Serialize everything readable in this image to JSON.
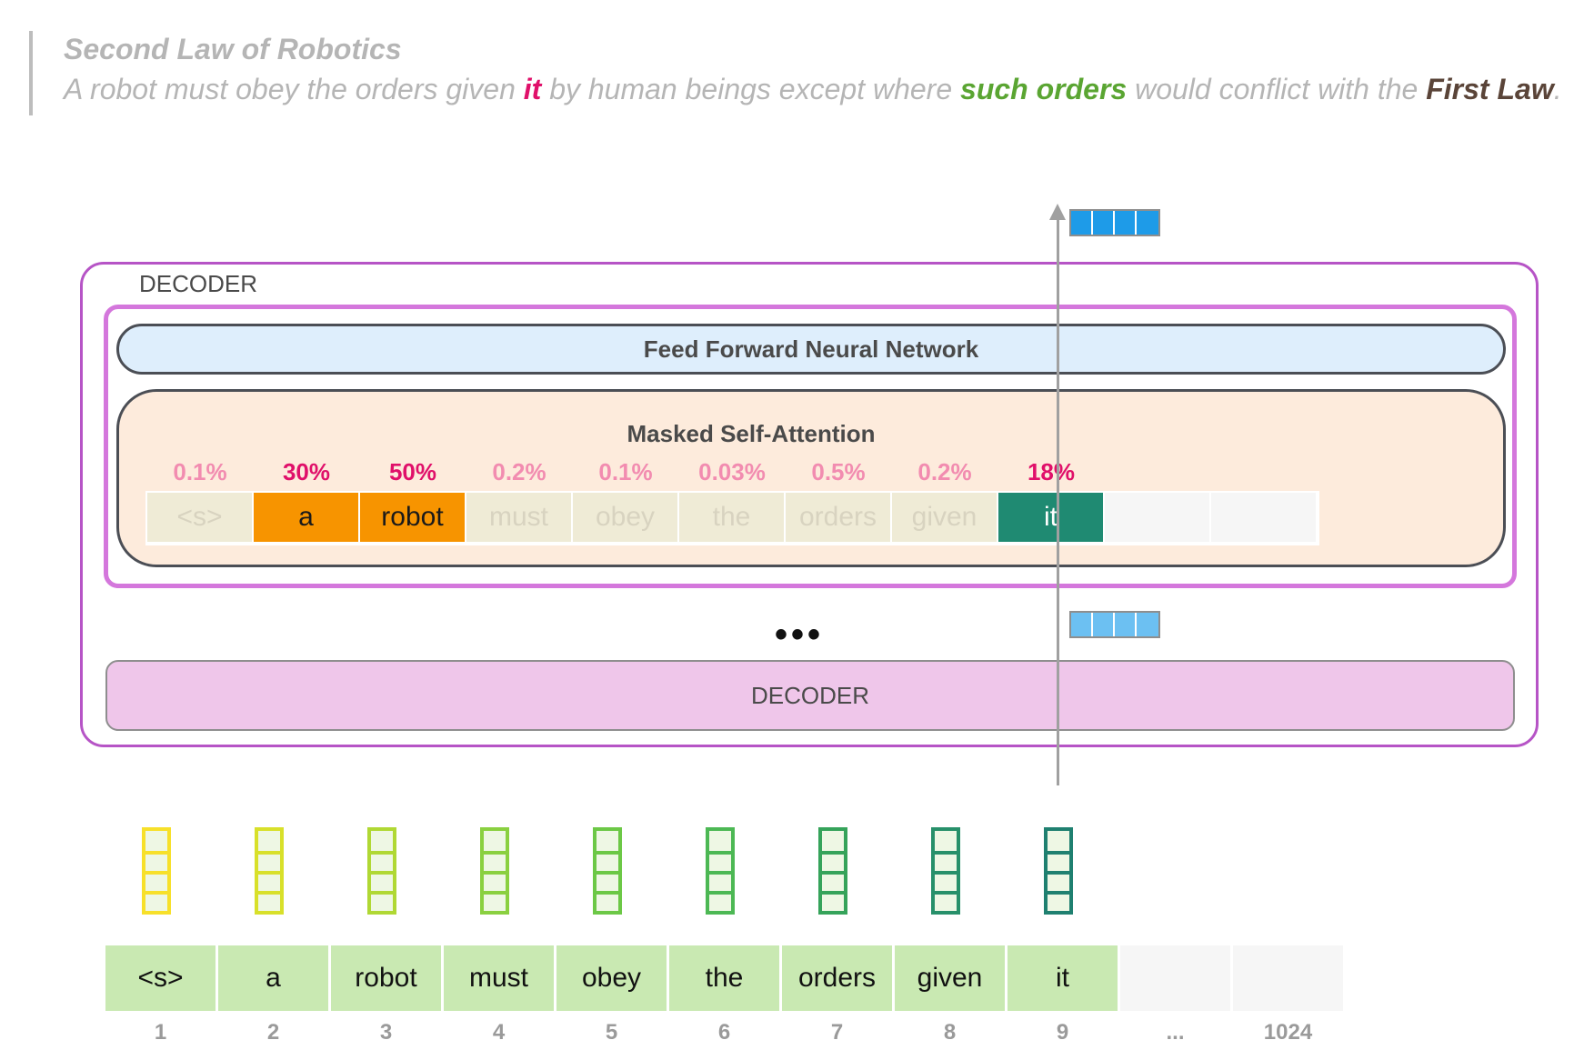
{
  "quote": {
    "title": "Second Law of Robotics",
    "text_part1": "A robot must obey the orders given ",
    "hl_it": "it",
    "text_part2": " by human beings except where ",
    "hl_orders": "such orders",
    "text_part3": " would conflict with the ",
    "hl_first_law": "First Law",
    "text_end": "."
  },
  "decoder": {
    "title": "DECODER",
    "ffnn_label": "Feed Forward Neural Network",
    "msa_label": "Masked Self-Attention",
    "dots": "•••",
    "bottom_label": "DECODER"
  },
  "attention": {
    "percents": [
      "0.1%",
      "30%",
      "50%",
      "0.2%",
      "0.1%",
      "0.03%",
      "0.5%",
      "0.2%",
      "18%"
    ],
    "emphasis": [
      false,
      true,
      true,
      false,
      false,
      false,
      false,
      false,
      true
    ],
    "tokens": [
      "<s>",
      "a",
      "robot",
      "must",
      "obey",
      "the",
      "orders",
      "given",
      "it",
      "",
      ""
    ],
    "styles": [
      "faded",
      "orange",
      "orange",
      "faded",
      "faded",
      "faded",
      "faded",
      "faded",
      "teal",
      "empty",
      "empty"
    ]
  },
  "input": {
    "tokens": [
      "<s>",
      "a",
      "robot",
      "must",
      "obey",
      "the",
      "orders",
      "given",
      "it",
      "",
      ""
    ],
    "positions": [
      "1",
      "2",
      "3",
      "4",
      "5",
      "6",
      "7",
      "8",
      "9",
      "...",
      "1024"
    ]
  },
  "colors": {
    "embedding_borders": [
      "#f7e02a",
      "#d8e02a",
      "#b0d834",
      "#8ad040",
      "#6cc846",
      "#4cb854",
      "#35a35a",
      "#27906a",
      "#1f8070"
    ],
    "embedding_fill": "#eef7e4",
    "output_vector": "#1e9be8",
    "hidden_vector": "#6cc0f2",
    "accent_orange": "#f79400",
    "accent_teal": "#1f8a72",
    "highlight_pink": "#e0106a"
  }
}
